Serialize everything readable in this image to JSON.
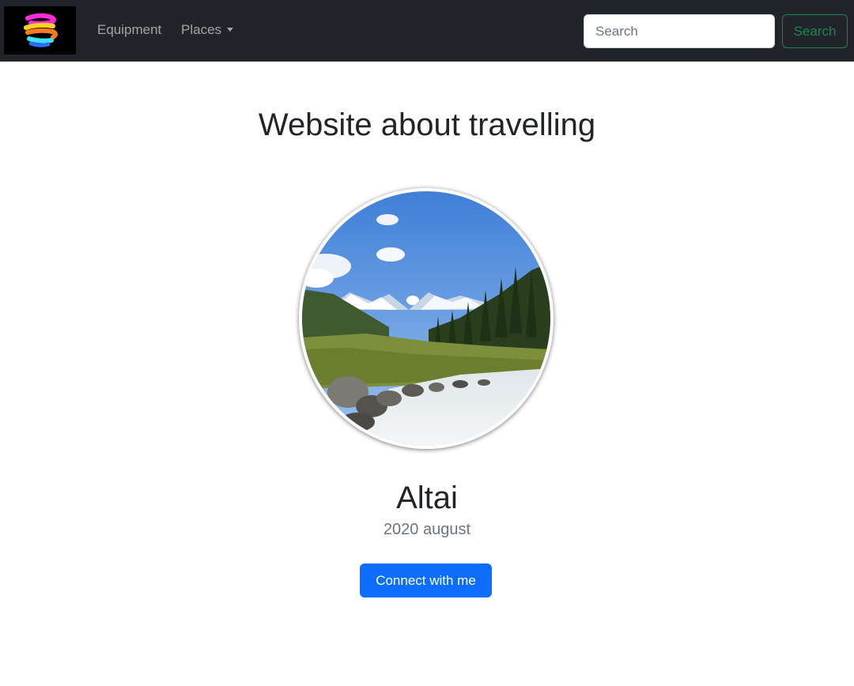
{
  "navbar": {
    "logo_icon": "striped-swirl-logo",
    "links": [
      {
        "label": "Equipment"
      },
      {
        "label": "Places",
        "dropdown": true
      }
    ],
    "search": {
      "placeholder": "Search",
      "button_label": "Search"
    }
  },
  "main": {
    "title": "Website about travelling",
    "photo_icon": "altai-mountain-river-photo",
    "place_name": "Altai",
    "date": "2020 august",
    "connect_label": "Connect with me"
  },
  "colors": {
    "navbar_bg": "#212529",
    "search_button": "#198754",
    "primary_button": "#0d6efd"
  }
}
